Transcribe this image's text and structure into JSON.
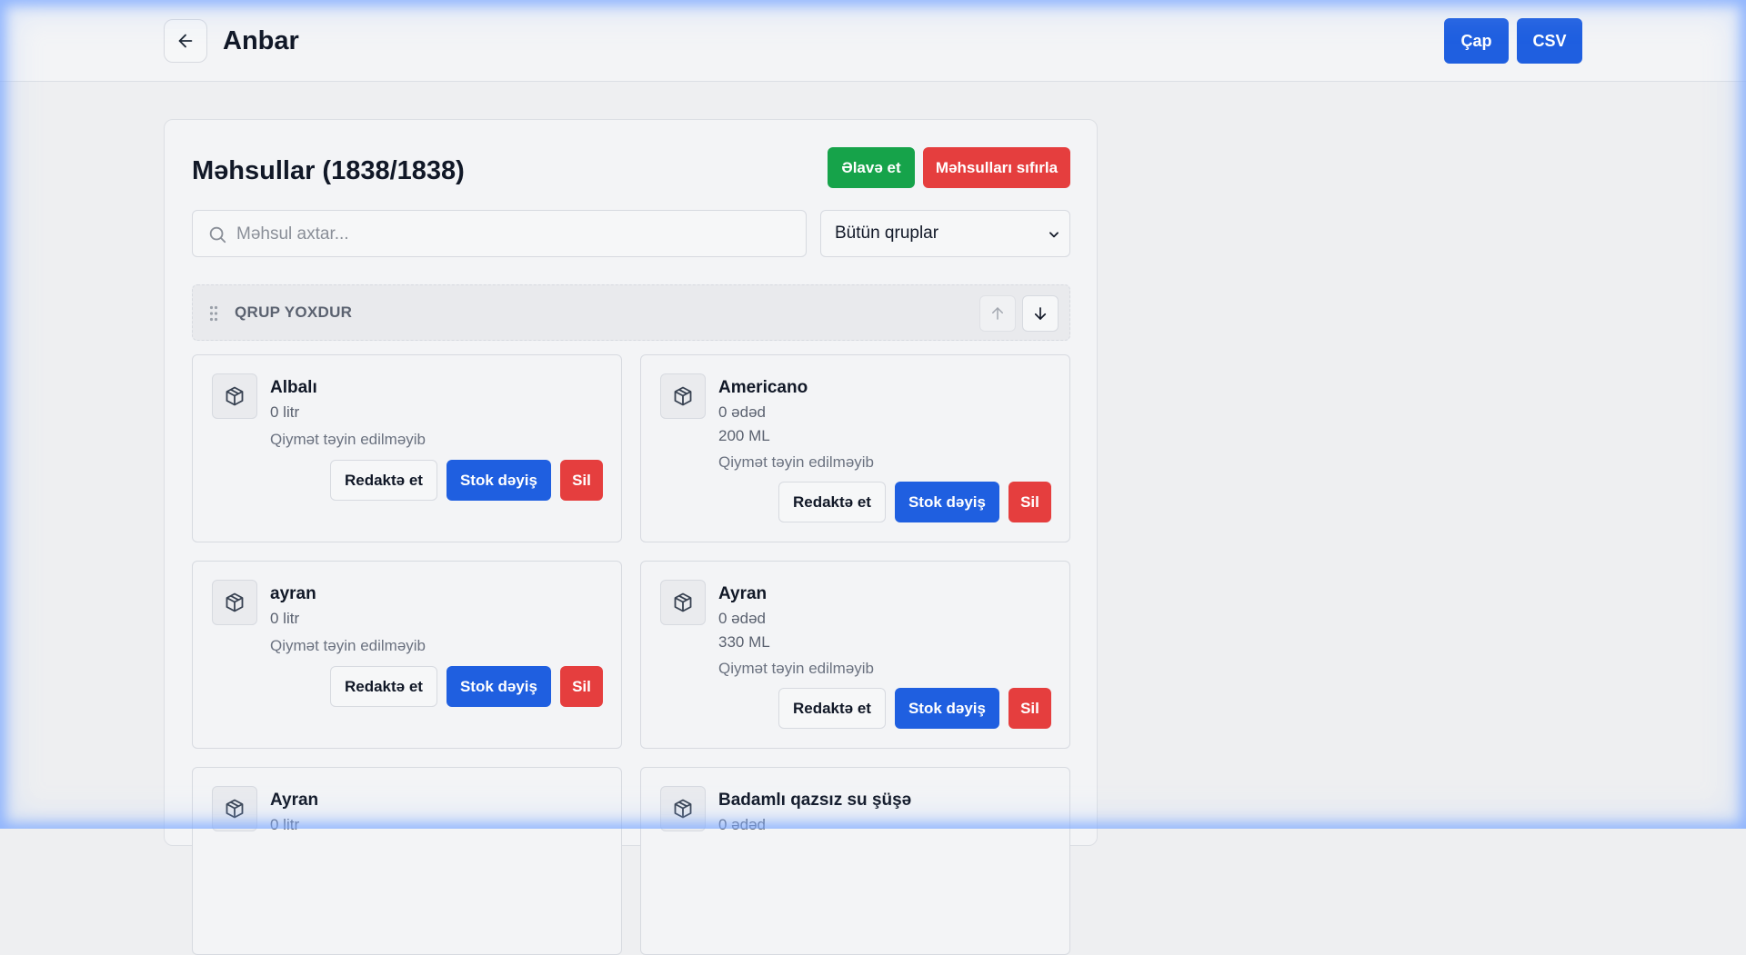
{
  "header": {
    "title": "Anbar",
    "print_label": "Çap",
    "csv_label": "CSV"
  },
  "products_section": {
    "title": "Məhsullar (1838/1838)",
    "add_label": "Əlavə et",
    "reset_label": "Məhsulları sıfırla",
    "search_placeholder": "Məhsul axtar...",
    "group_filter": {
      "selected": "Bütün qruplar"
    },
    "group": {
      "name": "QRUP YOXDUR"
    }
  },
  "card_actions": {
    "edit": "Redaktə et",
    "stock": "Stok dəyiş",
    "delete": "Sil"
  },
  "products": [
    {
      "name": "Albalı",
      "qty": "0 litr",
      "volume": "",
      "price": "Qiymət təyin edilməyib"
    },
    {
      "name": "Americano",
      "qty": "0 ədəd",
      "volume": "200 ML",
      "price": "Qiymət təyin edilməyib"
    },
    {
      "name": "ayran",
      "qty": "0 litr",
      "volume": "",
      "price": "Qiymət təyin edilməyib"
    },
    {
      "name": "Ayran",
      "qty": "0 ədəd",
      "volume": "330 ML",
      "price": "Qiymət təyin edilməyib"
    },
    {
      "name": "Ayran",
      "qty": "0 litr",
      "volume": "",
      "price": ""
    },
    {
      "name": "Badamlı qazsız su şüşə",
      "qty": "0 ədəd",
      "volume": "",
      "price": ""
    }
  ]
}
